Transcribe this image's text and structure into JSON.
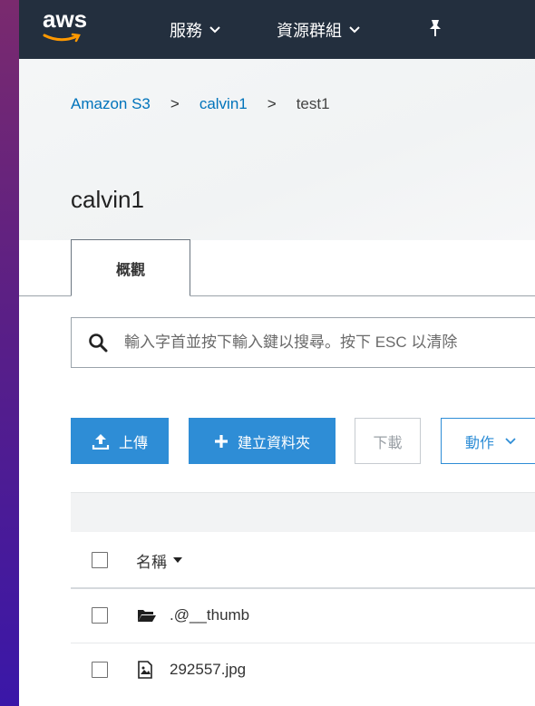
{
  "topnav": {
    "logo_text": "aws",
    "services_label": "服務",
    "resource_groups_label": "資源群組",
    "caret": "⌄",
    "pin_icon": "pin-icon"
  },
  "breadcrumb": {
    "root": "Amazon S3",
    "bucket": "calvin1",
    "folder": "test1",
    "separator": ">"
  },
  "page_title": "calvin1",
  "tabs": [
    {
      "label": "概觀",
      "active": true
    }
  ],
  "search": {
    "placeholder": "輸入字首並按下輸入鍵以搜尋。按下 ESC 以清除"
  },
  "toolbar": {
    "upload_label": "上傳",
    "new_folder_label": "建立資料夾",
    "download_label": "下載",
    "actions_label": "動作"
  },
  "table": {
    "columns": [
      "名稱"
    ],
    "rows": [
      {
        "name": ".@__thumb",
        "type": "folder"
      },
      {
        "name": "292557.jpg",
        "type": "image"
      }
    ]
  },
  "colors": {
    "nav_bg": "#232f3e",
    "primary": "#2e8dd6",
    "link": "#0073bb"
  }
}
